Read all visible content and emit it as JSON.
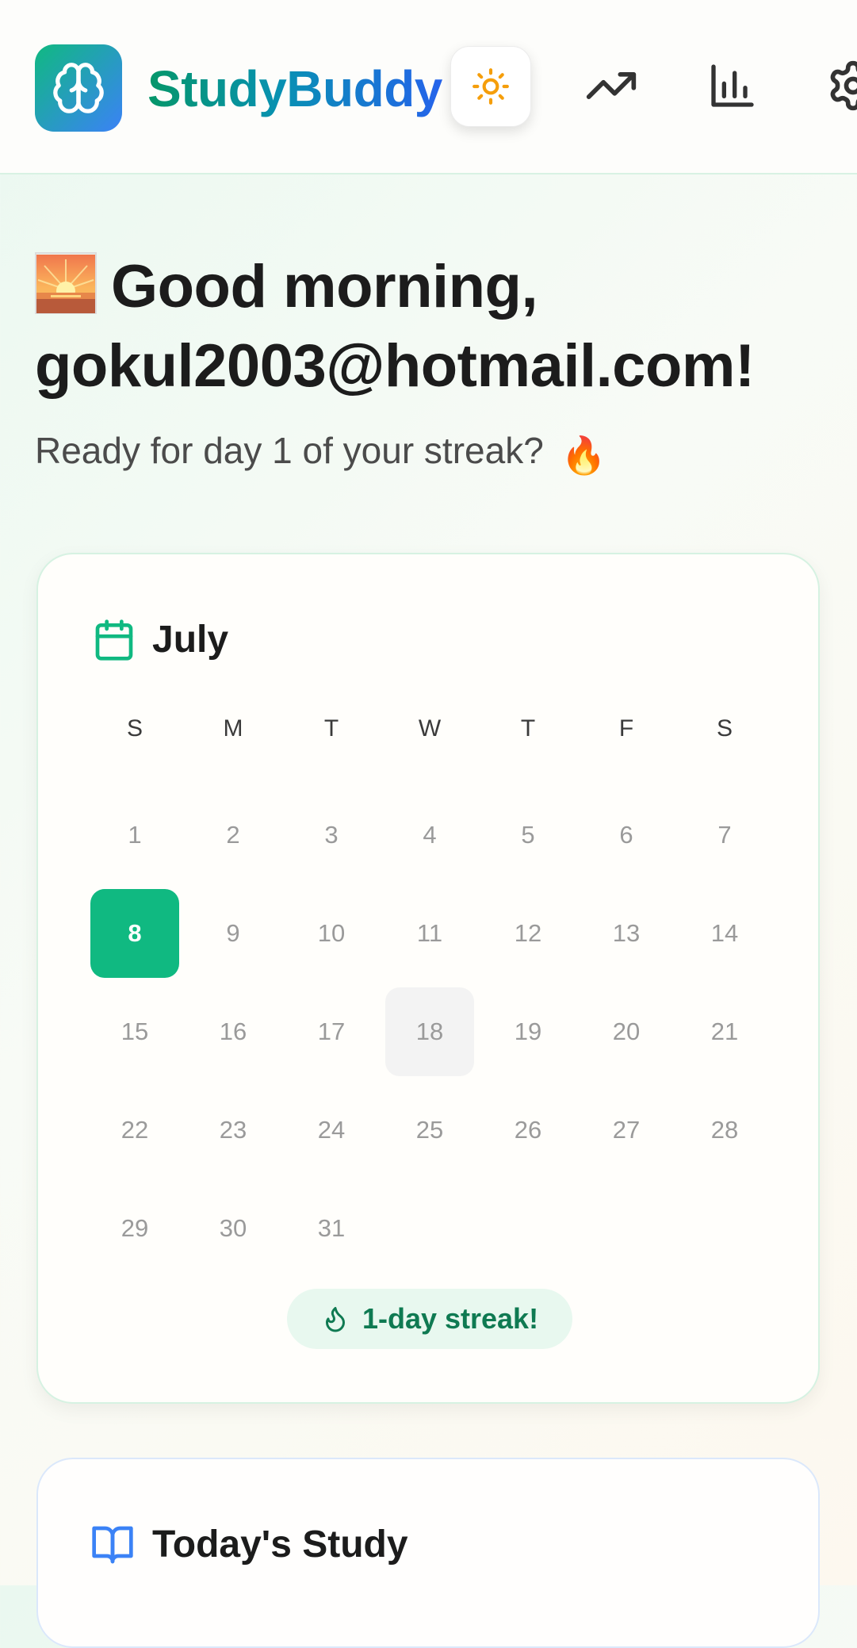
{
  "header": {
    "brand": "StudyBuddy",
    "logo_icon": "brain-icon",
    "theme_icon": "sun-icon",
    "nav_icons": [
      "trending-up-icon",
      "bar-chart-icon",
      "settings-gear-icon"
    ]
  },
  "greeting": {
    "emoji": "sunrise-emoji",
    "line": "Good morning, gokul2003@hotmail.com!",
    "subtitle": "Ready for day 1 of your streak?",
    "subtitle_emoji": "🔥"
  },
  "calendar": {
    "month": "July",
    "weekdays": [
      "S",
      "M",
      "T",
      "W",
      "T",
      "F",
      "S"
    ],
    "days": [
      "1",
      "2",
      "3",
      "4",
      "5",
      "6",
      "7",
      "8",
      "9",
      "10",
      "11",
      "12",
      "13",
      "14",
      "15",
      "16",
      "17",
      "18",
      "19",
      "20",
      "21",
      "22",
      "23",
      "24",
      "25",
      "26",
      "27",
      "28",
      "29",
      "30",
      "31"
    ],
    "selected_day": "8",
    "highlighted_day": "18",
    "streak_label": "1-day streak!"
  },
  "study": {
    "title": "Today's Study"
  },
  "colors": {
    "accent_green": "#10b981",
    "brand_blue": "#2563eb",
    "streak_text": "#0f7a52"
  }
}
